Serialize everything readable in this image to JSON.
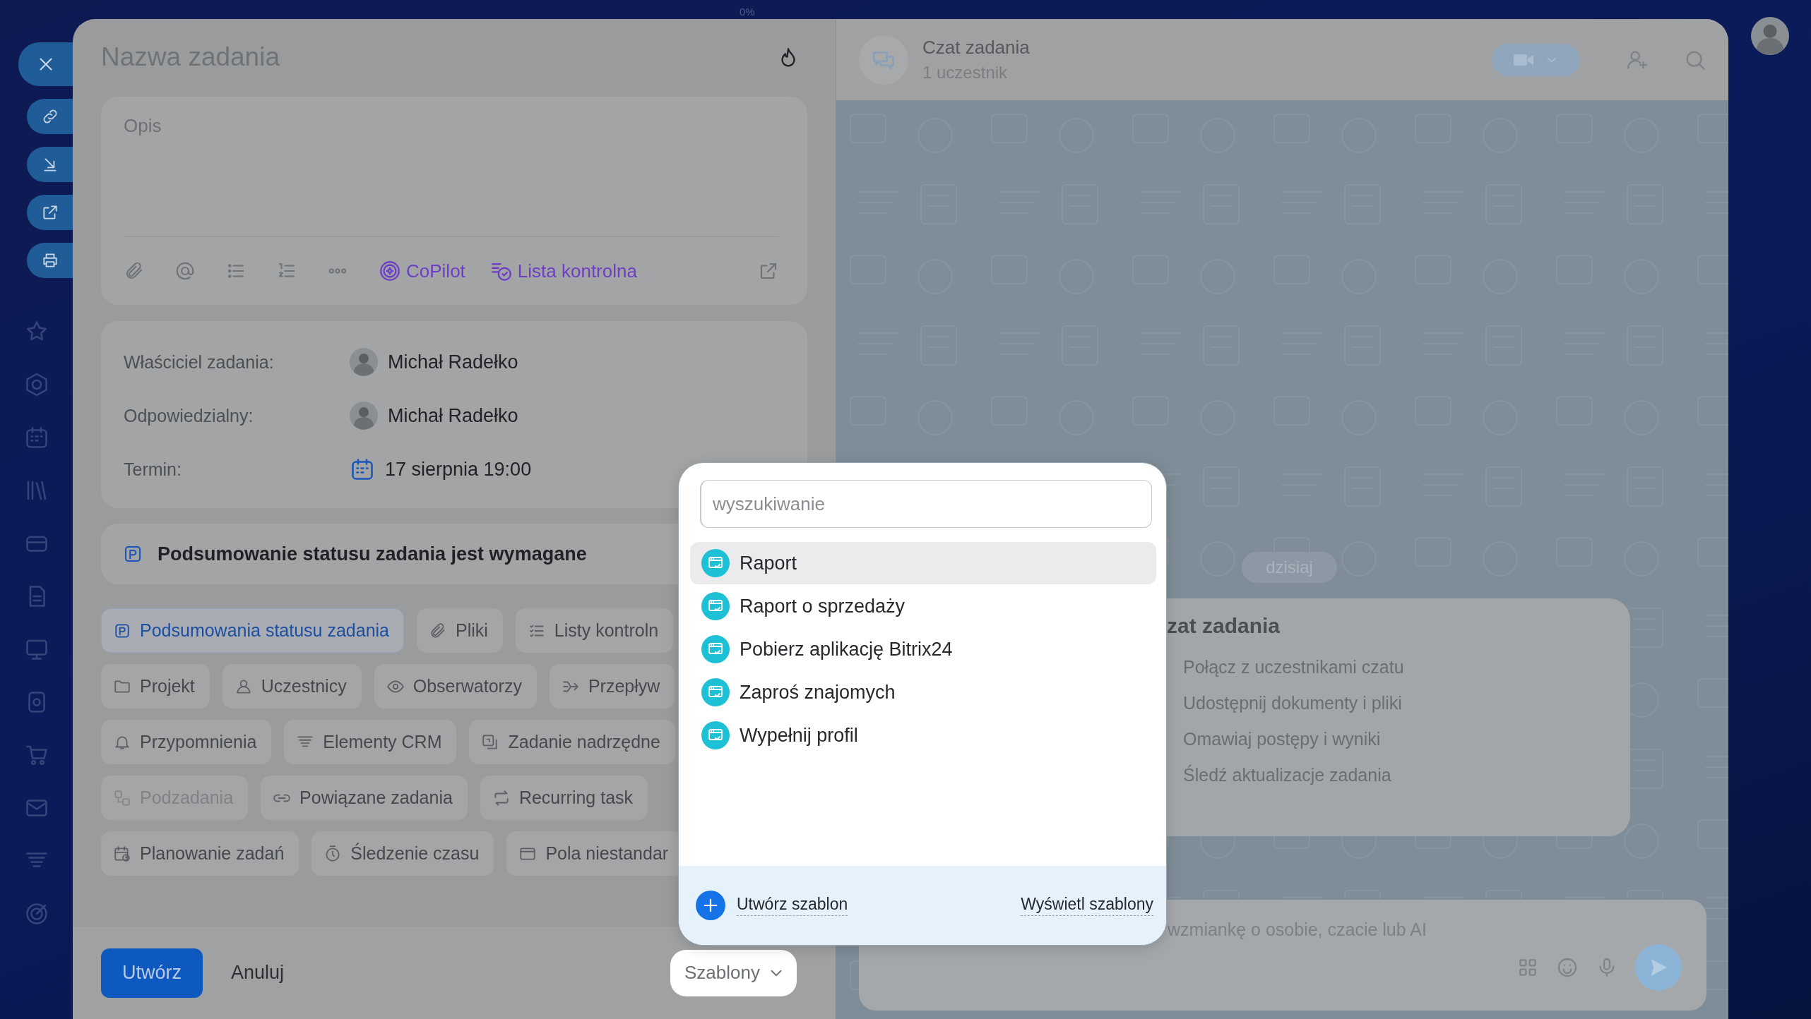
{
  "top_bar": {
    "progress": "0%"
  },
  "task": {
    "title": "Nazwa zadania",
    "description": {
      "placeholder": "Opis"
    },
    "toolbar": [
      {
        "label": "CoPilot"
      },
      {
        "label": "Lista kontrolna"
      }
    ],
    "fields": [
      {
        "label": "Właściciel zadania:",
        "value": "Michał Radełko",
        "kind": "person"
      },
      {
        "label": "Odpowiedzialny:",
        "value": "Michał Radełko",
        "kind": "person"
      },
      {
        "label": "Termin:",
        "value": "17 sierpnia 19:00",
        "kind": "date"
      }
    ],
    "notice": "Podsumowanie statusu zadania jest wymagane",
    "chip_rows": [
      [
        {
          "label": "Podsumowania statusu zadania",
          "selected": true,
          "disabled": false
        },
        {
          "label": "Pliki",
          "selected": false,
          "disabled": false
        },
        {
          "label": "Listy kontroln",
          "selected": false,
          "disabled": false
        }
      ],
      [
        {
          "label": "Projekt",
          "selected": false,
          "disabled": false
        },
        {
          "label": "Uczestnicy",
          "selected": false,
          "disabled": false
        },
        {
          "label": "Obserwatorzy",
          "selected": false,
          "disabled": false
        },
        {
          "label": "Przepływ",
          "selected": false,
          "disabled": false
        }
      ],
      [
        {
          "label": "Przypomnienia",
          "selected": false,
          "disabled": false
        },
        {
          "label": "Elementy CRM",
          "selected": false,
          "disabled": false
        },
        {
          "label": "Zadanie nadrzędne",
          "selected": false,
          "disabled": false
        }
      ],
      [
        {
          "label": "Podzadania",
          "selected": false,
          "disabled": true
        },
        {
          "label": "Powiązane zadania",
          "selected": false,
          "disabled": false
        },
        {
          "label": "Recurring task",
          "selected": false,
          "disabled": false
        }
      ],
      [
        {
          "label": "Planowanie zadań",
          "selected": false,
          "disabled": false
        },
        {
          "label": "Śledzenie czasu",
          "selected": false,
          "disabled": false
        },
        {
          "label": "Pola niestandar",
          "selected": false,
          "disabled": false
        }
      ]
    ],
    "buttons": {
      "create": "Utwórz",
      "cancel": "Anuluj",
      "templates": "Szablony"
    }
  },
  "chat": {
    "title": "Czat zadania",
    "subtitle": "1 uczestnik",
    "date_divider": "dzisiaj",
    "welcome": {
      "title": "zat zadania",
      "items": [
        "Połącz z uczestnikami czatu",
        "Udostępnij dokumenty i pliki",
        "Omawiaj postępy i wyniki",
        "Śledź aktualizacje zadania"
      ]
    },
    "composer": {
      "placeholder": "wzmiankę o osobie, czacie lub AI"
    }
  },
  "templates_popup": {
    "search": {
      "placeholder": "wyszukiwanie"
    },
    "items": [
      {
        "label": "Raport",
        "selected": true
      },
      {
        "label": "Raport o sprzedaży",
        "selected": false
      },
      {
        "label": "Pobierz aplikację Bitrix24",
        "selected": false
      },
      {
        "label": "Zaproś znajomych",
        "selected": false
      },
      {
        "label": "Wypełnij profil",
        "selected": false
      }
    ],
    "create": "Utwórz szablon",
    "view": "Wyświetl szablony"
  }
}
